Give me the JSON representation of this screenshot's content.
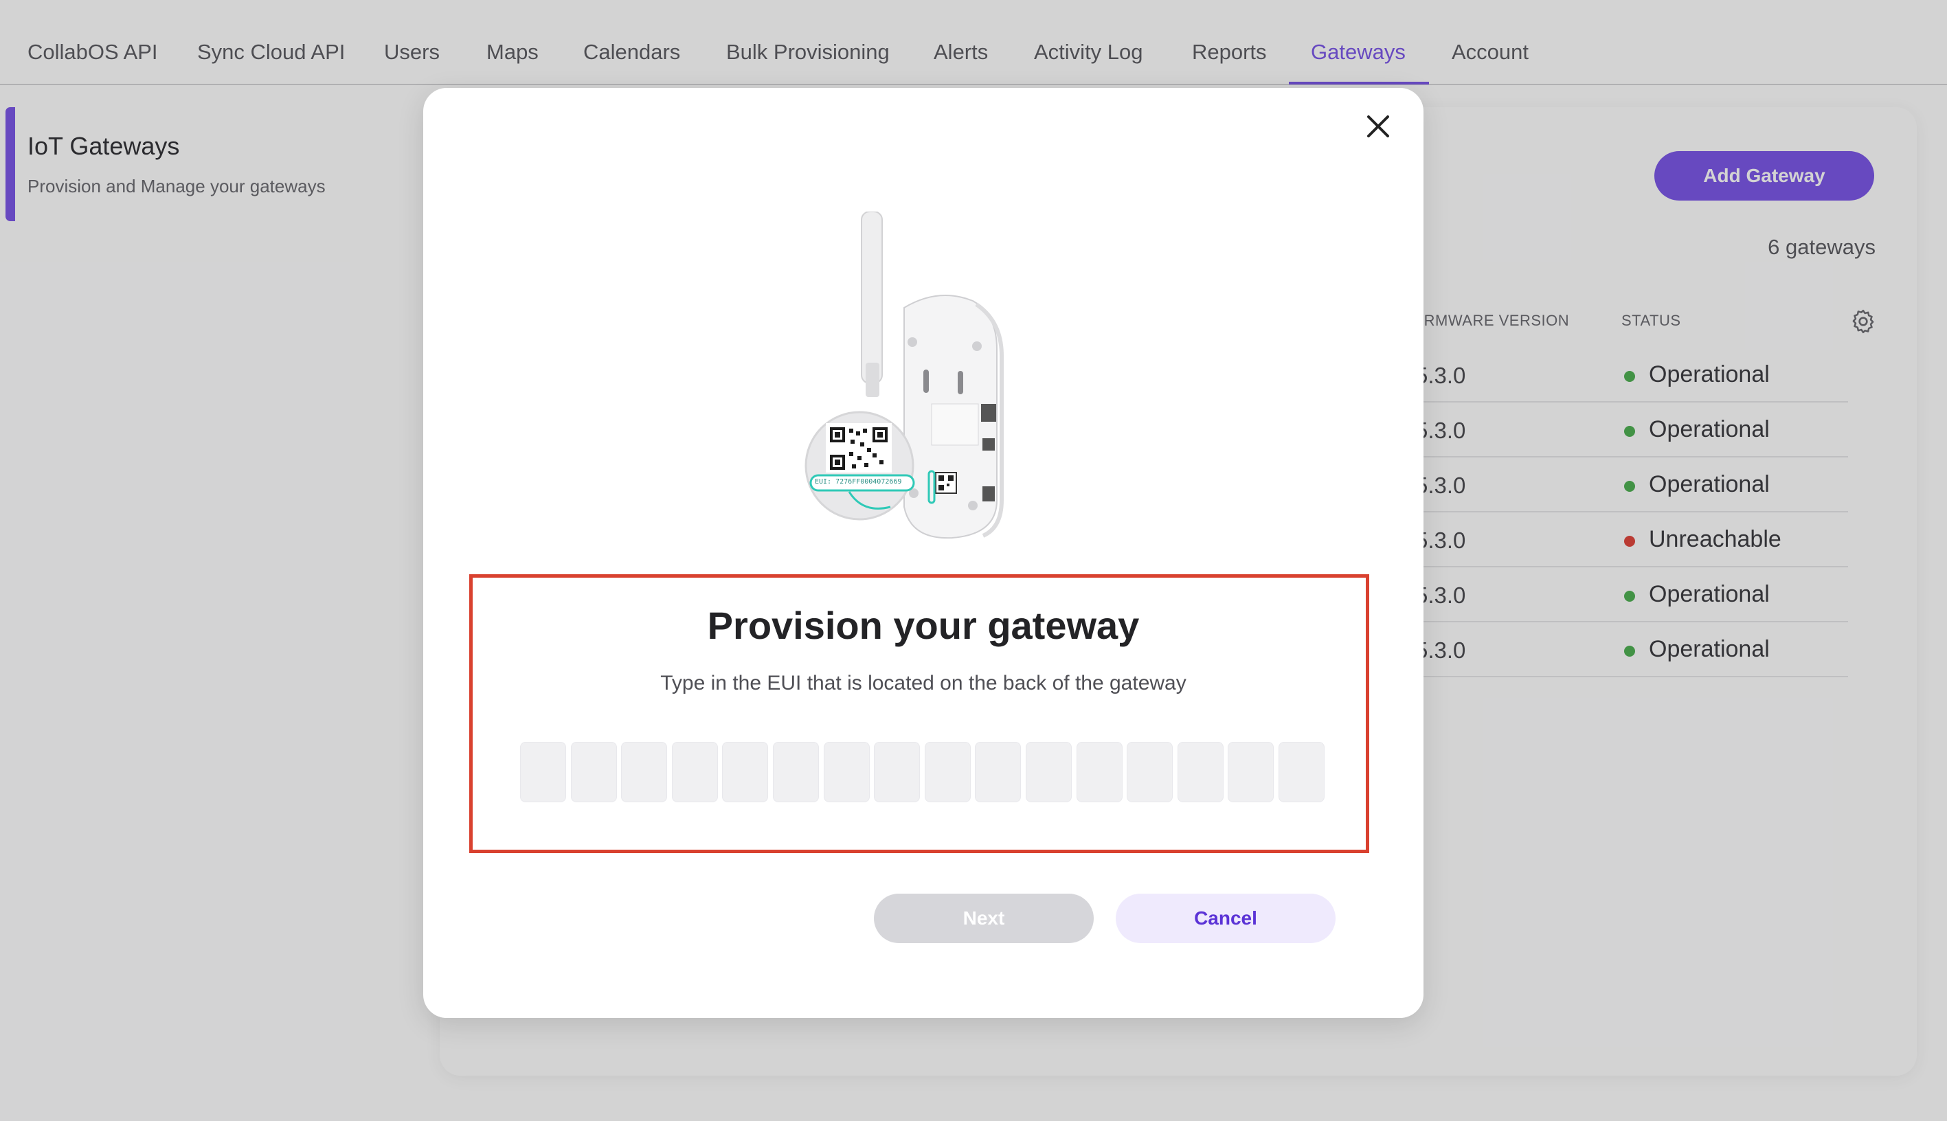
{
  "nav": {
    "tabs": [
      {
        "label": "CollabOS API"
      },
      {
        "label": "Sync Cloud API"
      },
      {
        "label": "Users"
      },
      {
        "label": "Maps"
      },
      {
        "label": "Calendars"
      },
      {
        "label": "Bulk Provisioning"
      },
      {
        "label": "Alerts"
      },
      {
        "label": "Activity Log"
      },
      {
        "label": "Reports"
      },
      {
        "label": "Gateways"
      },
      {
        "label": "Account"
      }
    ],
    "active_tab": "Gateways"
  },
  "sidebar": {
    "title": "IoT Gateways",
    "subtitle": "Provision and Manage your gateways"
  },
  "main": {
    "add_button": "Add Gateway",
    "count_label": "6 gateways",
    "columns": [
      "IRMWARE VERSION",
      "STATUS"
    ],
    "rows": [
      {
        "firmware": "5.3.0",
        "status": "Operational",
        "status_color": "#4caf50"
      },
      {
        "firmware": "5.3.0",
        "status": "Operational",
        "status_color": "#4caf50"
      },
      {
        "firmware": "5.3.0",
        "status": "Operational",
        "status_color": "#4caf50"
      },
      {
        "firmware": "5.3.0",
        "status": "Unreachable",
        "status_color": "#e0443a"
      },
      {
        "firmware": "5.3.0",
        "status": "Operational",
        "status_color": "#4caf50"
      },
      {
        "firmware": "5.3.0",
        "status": "Operational",
        "status_color": "#4caf50"
      }
    ]
  },
  "modal": {
    "title": "Provision your gateway",
    "subtitle": "Type in the EUI that is located on the back of the gateway",
    "eui_box_count": 16,
    "next_label": "Next",
    "cancel_label": "Cancel",
    "illustration_label": "EUI: 7276FF0004072669",
    "icons": {
      "close": "close-icon",
      "settings": "gear-icon"
    }
  },
  "colors": {
    "accent": "#7a55e8",
    "highlight": "#d9412f",
    "operational": "#4caf50",
    "unreachable": "#e0443a"
  }
}
